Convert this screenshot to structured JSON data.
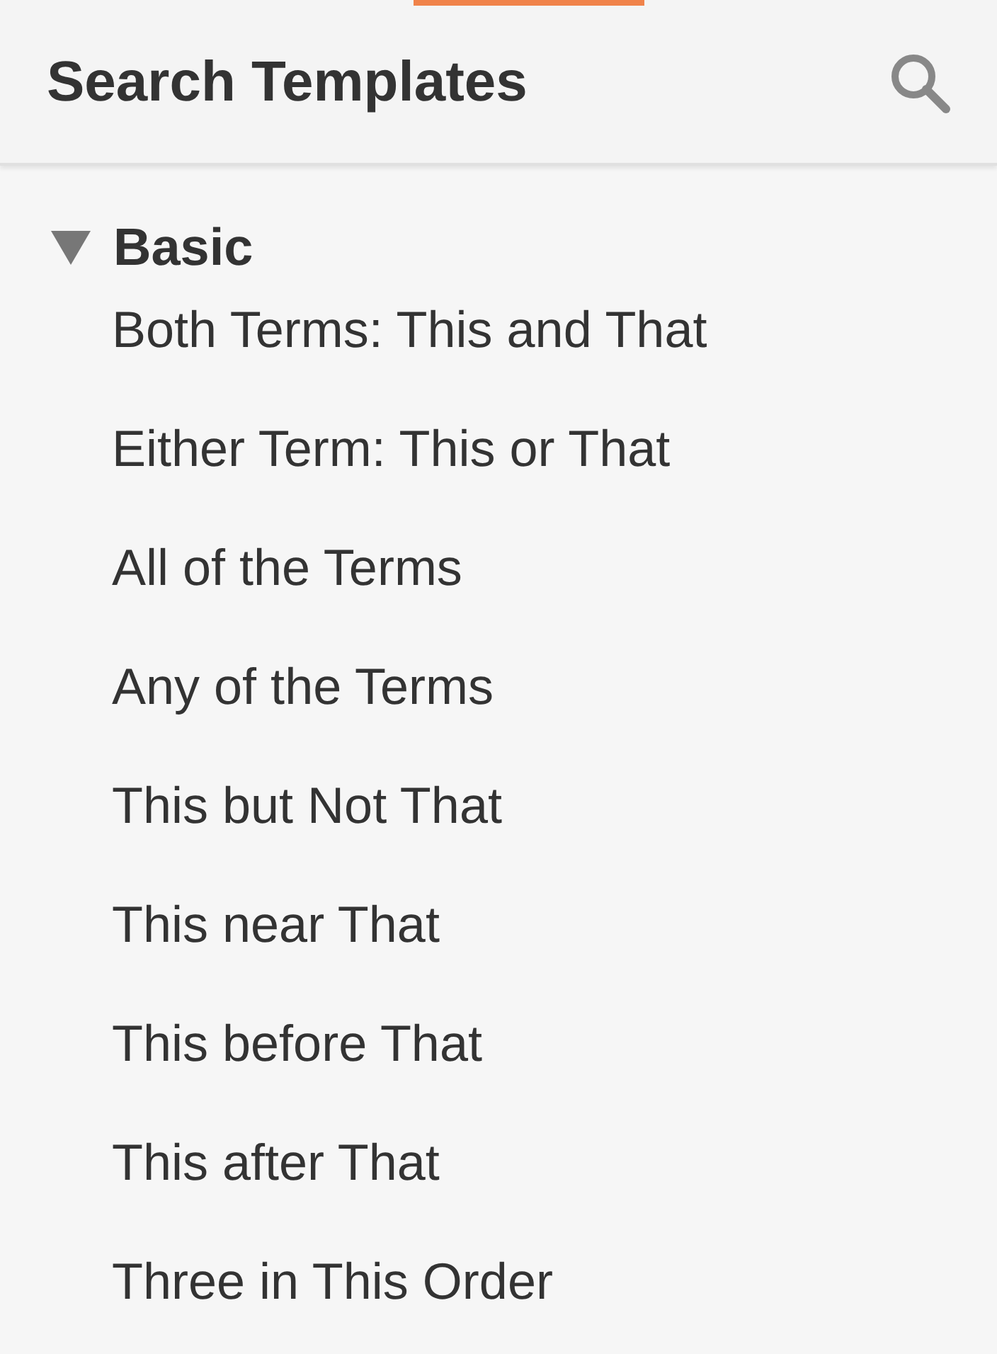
{
  "header": {
    "title": "Search Templates"
  },
  "groups": [
    {
      "label": "Basic",
      "expanded": true,
      "children": [
        {
          "label": "Both Terms: This and That"
        },
        {
          "label": "Either Term: This or That"
        },
        {
          "label": "All of the Terms"
        },
        {
          "label": "Any of the Terms"
        },
        {
          "label": "This but Not That"
        },
        {
          "label": "This near That"
        },
        {
          "label": "This before That"
        },
        {
          "label": "This after That"
        },
        {
          "label": "Three in This Order"
        }
      ]
    }
  ]
}
